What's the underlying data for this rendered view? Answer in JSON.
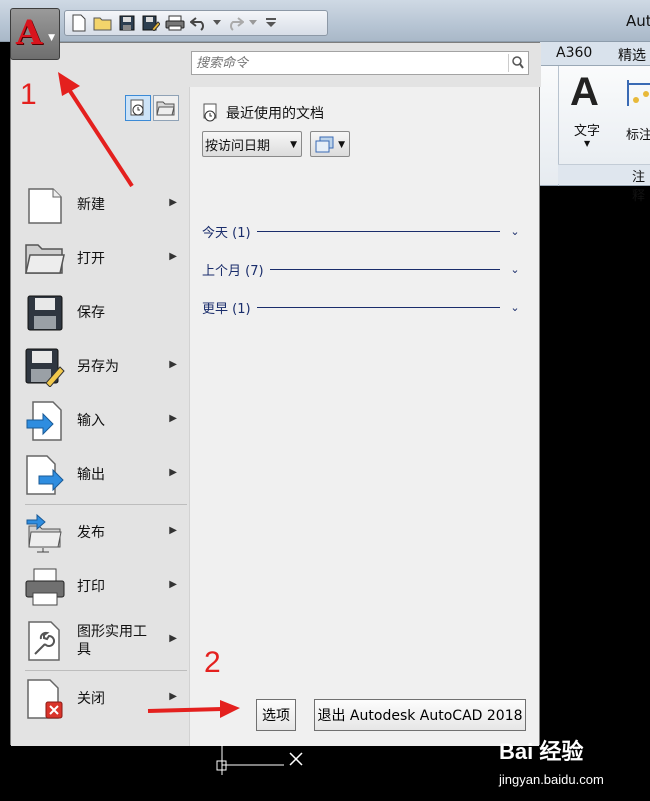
{
  "window": {
    "title": "Auto"
  },
  "app_button": {
    "logo": "A"
  },
  "ribbon": {
    "tabs": [
      "A360",
      "精选"
    ],
    "buttons": [
      {
        "label": "文字"
      },
      {
        "label": "标注"
      }
    ],
    "panel_title": "注释"
  },
  "search": {
    "placeholder": "搜索命令"
  },
  "menu_items": [
    {
      "label": "新建",
      "icon": "new-file-icon",
      "has_submenu": true
    },
    {
      "label": "打开",
      "icon": "open-folder-icon",
      "has_submenu": true
    },
    {
      "label": "保存",
      "icon": "save-disk-icon",
      "has_submenu": false
    },
    {
      "label": "另存为",
      "icon": "save-as-icon",
      "has_submenu": true
    },
    {
      "label": "输入",
      "icon": "import-icon",
      "has_submenu": true
    },
    {
      "label": "输出",
      "icon": "export-icon",
      "has_submenu": true
    },
    {
      "label": "发布",
      "icon": "publish-icon",
      "has_submenu": true
    },
    {
      "label": "打印",
      "icon": "printer-icon",
      "has_submenu": true
    },
    {
      "label": "图形实用工具",
      "icon": "wrench-icon",
      "has_submenu": true
    },
    {
      "label": "关闭",
      "icon": "close-file-icon",
      "has_submenu": true
    }
  ],
  "recent": {
    "header": "最近使用的文档",
    "sort_by": "按访问日期",
    "groups": [
      {
        "label": "今天 (1)"
      },
      {
        "label": "上个月 (7)"
      },
      {
        "label": "更早 (1)"
      }
    ]
  },
  "buttons": {
    "options": "选项",
    "exit": "退出 Autodesk AutoCAD 2018"
  },
  "annotations": {
    "step1": "1",
    "step2": "2"
  },
  "watermark": {
    "main": "Bai 经验",
    "sub": "jingyan.baidu.com"
  },
  "colors": {
    "annotation_red": "#e4201e",
    "autocad_red": "#d8141d",
    "group_navy": "#1a2d6b"
  }
}
